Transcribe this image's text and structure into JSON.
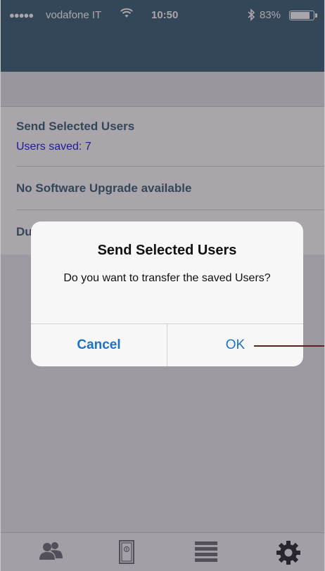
{
  "status_bar": {
    "signal": "●●●●●",
    "carrier": "vodafone IT",
    "wifi_icon": "wifi-icon",
    "time": "10:50",
    "bluetooth_icon": "bluetooth-icon",
    "battery_percent": "83%",
    "battery_level": 0.83
  },
  "list": {
    "send_title": "Send Selected Users",
    "users_saved": "Users saved: 7",
    "upgrade": "No Software Upgrade available",
    "partial_row": "Du"
  },
  "alert": {
    "title": "Send Selected Users",
    "message": "Do you want to transfer the saved Users?",
    "cancel_label": "Cancel",
    "ok_label": "OK"
  },
  "tabbar": {
    "tabs": [
      {
        "icon": "users-icon"
      },
      {
        "icon": "door-icon"
      },
      {
        "icon": "list-icon"
      },
      {
        "icon": "gear-icon"
      }
    ]
  },
  "colors": {
    "header": "#3c6377",
    "accent_text": "#3c6377",
    "saved_text": "#1a1ad8",
    "alert_button": "#1a73c8",
    "callout": "#5a2222"
  }
}
